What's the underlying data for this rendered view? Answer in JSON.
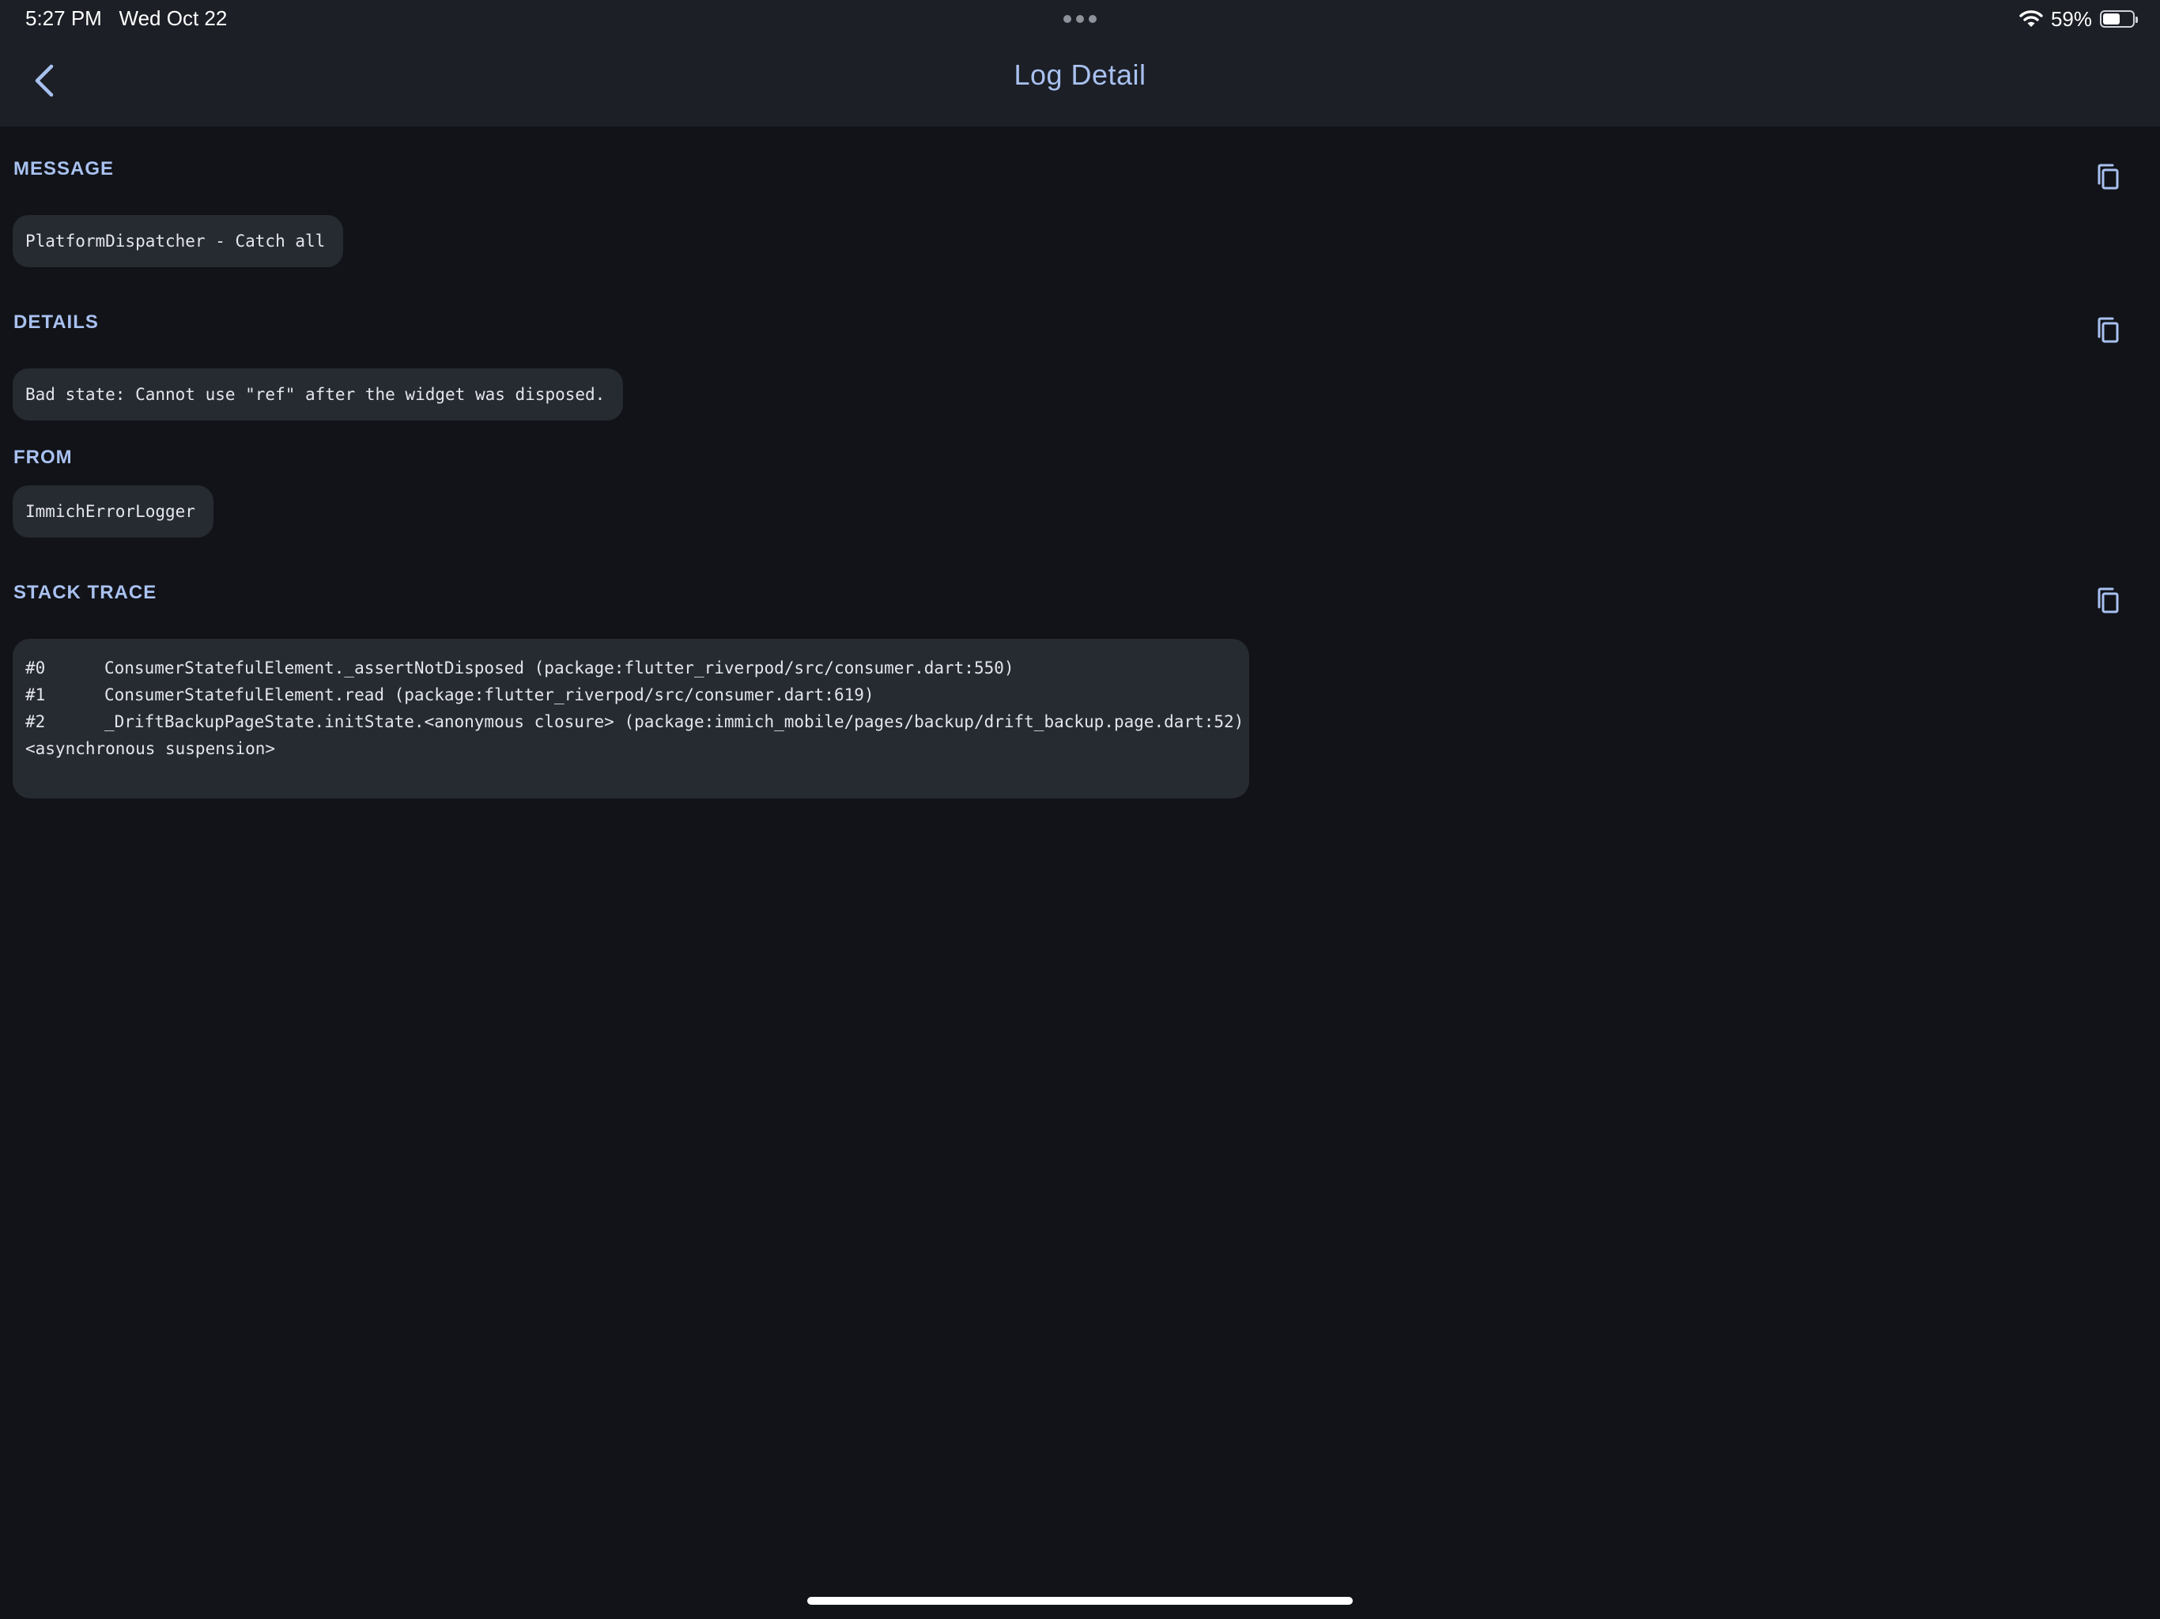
{
  "status_bar": {
    "time": "5:27 PM",
    "date": "Wed Oct 22",
    "battery_percent": "59%",
    "battery_level": 0.59,
    "icons": [
      "multitasking-dots-icon",
      "wifi-icon",
      "battery-icon"
    ]
  },
  "nav": {
    "back_icon": "chevron-left-icon",
    "title": "Log Detail"
  },
  "sections": {
    "message": {
      "label": "MESSAGE",
      "value": "PlatformDispatcher - Catch all"
    },
    "details": {
      "label": "DETAILS",
      "value": "Bad state: Cannot use \"ref\" after the widget was disposed."
    },
    "from": {
      "label": "FROM",
      "value": "ImmichErrorLogger"
    },
    "stack_trace": {
      "label": "STACK TRACE",
      "frames": [
        {
          "num": "#0",
          "text": "ConsumerStatefulElement._assertNotDisposed (package:flutter_riverpod/src/consumer.dart:550)"
        },
        {
          "num": "#1",
          "text": "ConsumerStatefulElement.read (package:flutter_riverpod/src/consumer.dart:619)"
        },
        {
          "num": "#2",
          "text": "_DriftBackupPageState.initState.<anonymous closure> (package:immich_mobile/pages/backup/drift_backup.page.dart:52)"
        }
      ],
      "suspension": "<asynchronous suspension>"
    }
  },
  "copy_icon": "copy-icon",
  "colors": {
    "background": "#111318",
    "header": "#1c1f25",
    "accent": "#a9c1f0",
    "surface": "#262a31",
    "text": "#e4e6ec"
  }
}
